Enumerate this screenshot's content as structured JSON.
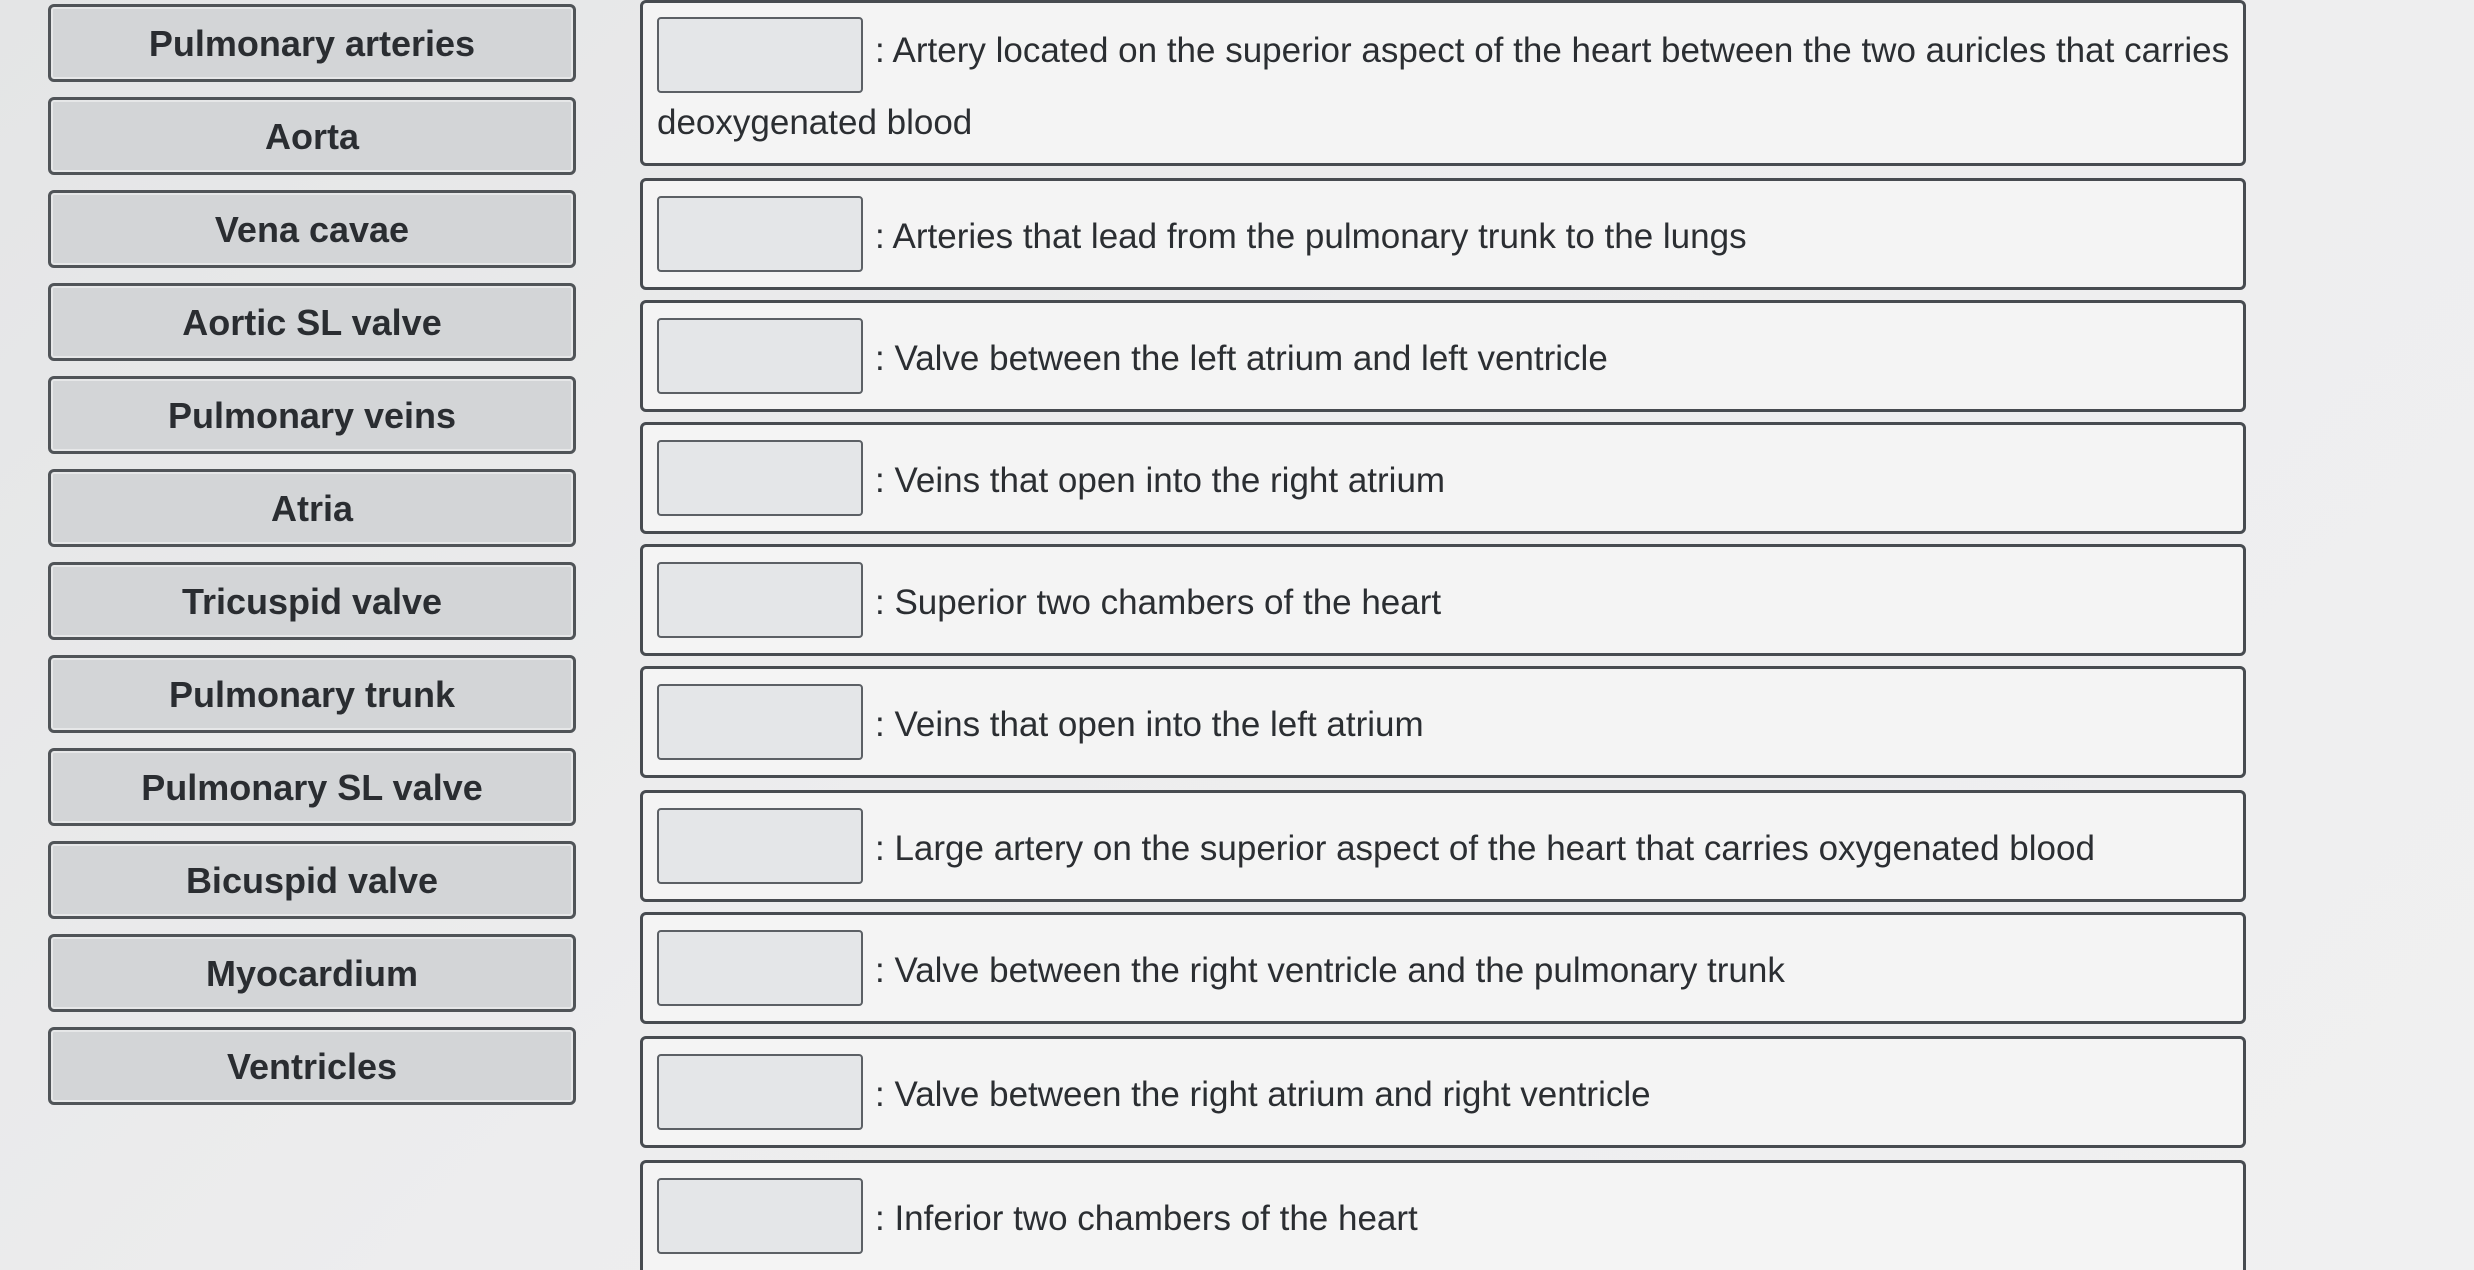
{
  "terms": [
    {
      "label": "Pulmonary arteries"
    },
    {
      "label": "Aorta"
    },
    {
      "label": "Vena cavae"
    },
    {
      "label": "Aortic SL valve"
    },
    {
      "label": "Pulmonary veins"
    },
    {
      "label": "Atria"
    },
    {
      "label": "Tricuspid valve"
    },
    {
      "label": "Pulmonary trunk"
    },
    {
      "label": "Pulmonary SL valve"
    },
    {
      "label": "Bicuspid valve"
    },
    {
      "label": "Myocardium"
    },
    {
      "label": "Ventricles"
    }
  ],
  "questions": [
    {
      "text": ": Artery located on the superior aspect of the heart between the two auricles that carries",
      "text_cont": "deoxygenated blood"
    },
    {
      "text": ": Arteries that lead from the pulmonary trunk to the lungs"
    },
    {
      "text": ": Valve between the left atrium and left ventricle"
    },
    {
      "text": ": Veins that open into the right atrium"
    },
    {
      "text": ": Superior two chambers of the heart"
    },
    {
      "text": ": Veins that open into the left atrium"
    },
    {
      "text": ": Large artery on the superior aspect of the heart that carries oxygenated blood"
    },
    {
      "text": ": Valve between the right ventricle and the pulmonary trunk"
    },
    {
      "text": ": Valve between the right atrium and right ventricle"
    },
    {
      "text": ": Inferior two chambers of the heart"
    }
  ]
}
